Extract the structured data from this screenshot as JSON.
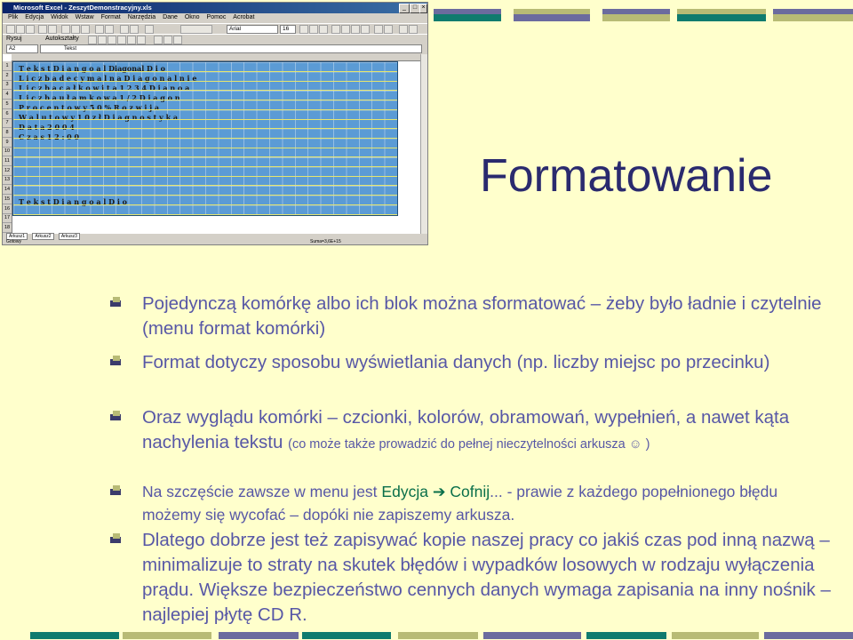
{
  "excel": {
    "title": "Microsoft Excel - ZeszytDemonstracyjny.xls",
    "menu": [
      "Plik",
      "Edycja",
      "Widok",
      "Wstaw",
      "Format",
      "Narzędzia",
      "Dane",
      "Okno",
      "Pomoc",
      "Acrobat"
    ],
    "font_name": "Arial",
    "font_size": "16",
    "toolbar2_labels": [
      "Rysuj",
      "Autokształty"
    ],
    "namebox": "A2",
    "formula": "Tekst",
    "row_numbers": [
      "1",
      "2",
      "3",
      "4",
      "5",
      "6",
      "7",
      "8",
      "9",
      "10",
      "11",
      "12",
      "13",
      "14",
      "15",
      "16",
      "17",
      "18"
    ],
    "rows": [
      "T e k s t          D i a n g o a l      Diagonal      D i o",
      "L i c z b a  d e c y m a l n a    D i a g o n a l n i e",
      "L i c z b a  c a ł k o w i t a  1 2 3 4  D i a n o a",
      "L i c z b a  u ł a m k o w a  1 / 2  D i a g o n",
      "P r o c e n t o w y   5 0 %   R o z w i j a",
      "W a l u t o w y   1 0 z ł   D i a g n o s t y k a",
      "D a t a   2 0 0 4",
      "C z a s   1 2 : 0 0",
      "T e k s t   D i a n g o a l   D i o"
    ],
    "sheets": [
      "Arkusz1",
      "Arkusz2",
      "Arkusz3"
    ],
    "status_left": "Gotowy",
    "status_right": "Suma=3,6E+15"
  },
  "slide": {
    "title": "Formatowanie",
    "bullets": [
      {
        "main": "Pojedynczą komórkę albo ich blok można sformatować  – żeby było ładnie i czytelnie  (menu format  komórki)"
      },
      {
        "main": "Format dotyczy sposobu wyświetlania danych (np. liczby miejsc po przecinku)"
      },
      {
        "main": "Oraz wyglądu komórki – czcionki, kolorów, obramowań, wypełnień, a nawet kąta nachylenia tekstu",
        "note": "(co może także prowadzić do pełnej nieczytelności arkusza ☺ )"
      },
      {
        "main_before": "Na szczęście zawsze w menu jest",
        "menu_a": "Edycja",
        "menu_b": "Cofnij",
        "main_after": "... - prawie z każdego popełnionego błędu możemy się wycofać – dopóki nie zapiszemy arkusza."
      },
      {
        "red": "Dlatego dobrze jest też zapisywać kopie naszej pracy co jakiś czas pod inną nazwą – minimalizuje to straty na skutek błędów i wypadków losowych w rodzaju wyłączenia prądu. Większe bezpieczeństwo cennych danych wymaga zapisania na inny nośnik – najlepiej płytę CD R."
      }
    ]
  },
  "colors": {
    "background": "#ffffcc",
    "title": "#2a2a6e",
    "bullet_text": "#5757a6",
    "red_text": "#b0003a",
    "menu_text": "#0a6f4a",
    "deco_teal": "#0f7b6e",
    "deco_khaki": "#b8bb75",
    "deco_purple": "#6b6b9e"
  }
}
